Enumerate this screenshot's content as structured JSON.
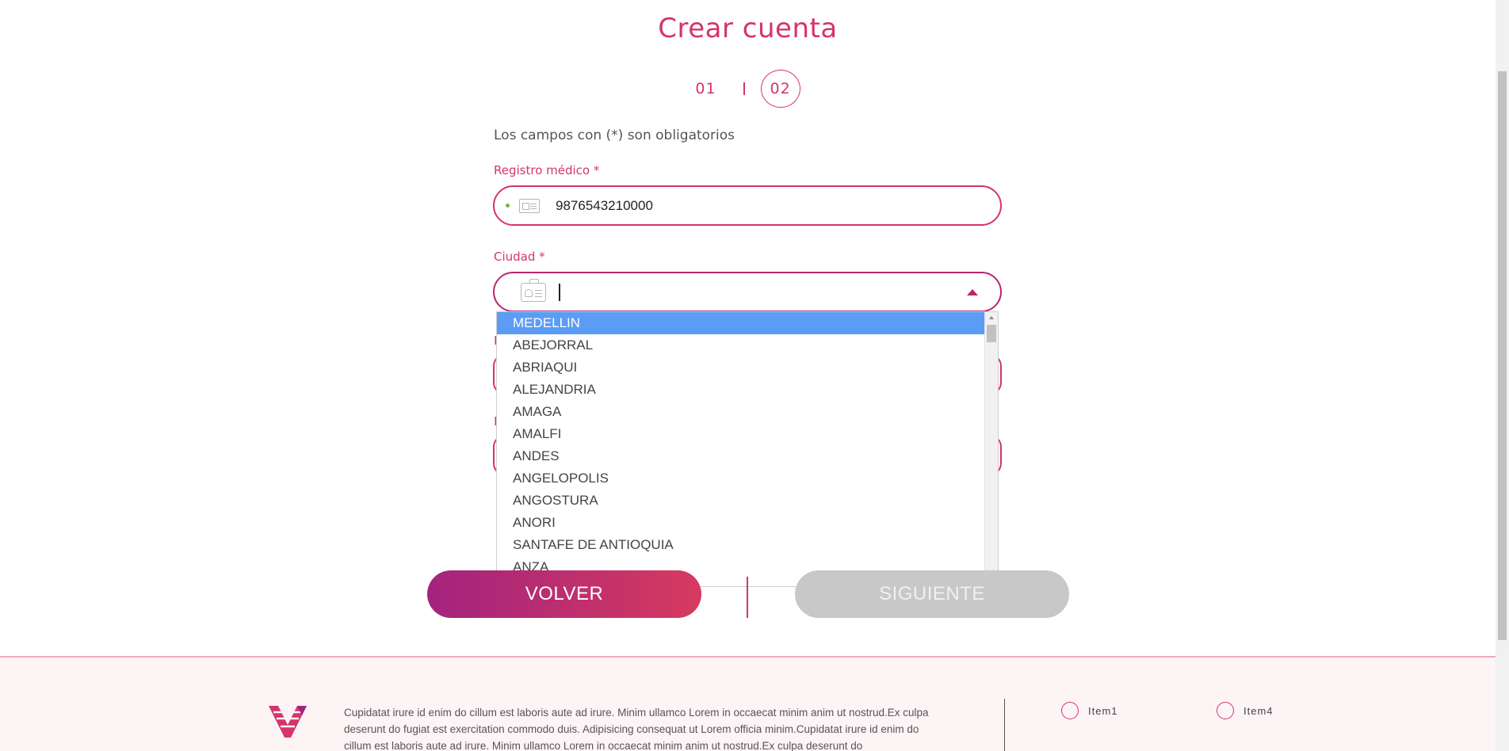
{
  "header": {
    "title": "Crear cuenta"
  },
  "steps": {
    "step1": "01",
    "step2": "02",
    "active_step": 2
  },
  "form": {
    "required_note": "Los campos con (*) son obligatorios",
    "registro": {
      "label": "Registro médico *",
      "value": "9876543210000"
    },
    "ciudad": {
      "label": "Ciudad *",
      "value": "",
      "options": [
        "MEDELLIN",
        "ABEJORRAL",
        "ABRIAQUI",
        "ALEJANDRIA",
        "AMAGA",
        "AMALFI",
        "ANDES",
        "ANGELOPOLIS",
        "ANGOSTURA",
        "ANORI",
        "SANTAFE DE ANTIOQUIA",
        "ANZA"
      ],
      "highlighted_option": "MEDELLIN"
    }
  },
  "buttons": {
    "back": "VOLVER",
    "next": "SIGUIENTE"
  },
  "footer": {
    "text": "Cupidatat irure id enim do cillum est laboris aute ad irure. Minim ullamco Lorem in occaecat minim anim ut nostrud.Ex culpa deserunt do fugiat est exercitation commodo duis. Adipisicing consequat ut Lorem officia minim.Cupidatat irure id enim do cillum est laboris aute ad irure. Minim ullamco Lorem in occaecat minim anim ut nostrud.Ex culpa deserunt do",
    "items": [
      "Item1",
      "Item4"
    ]
  },
  "colors": {
    "accent": "#d6336c",
    "accent_dark": "#b8266f",
    "selection": "#5b9cf6",
    "disabled": "#c8c8c8"
  },
  "icons": [
    "id-card-icon",
    "badge-icon",
    "caret-up-icon",
    "brand-logo-icon"
  ]
}
